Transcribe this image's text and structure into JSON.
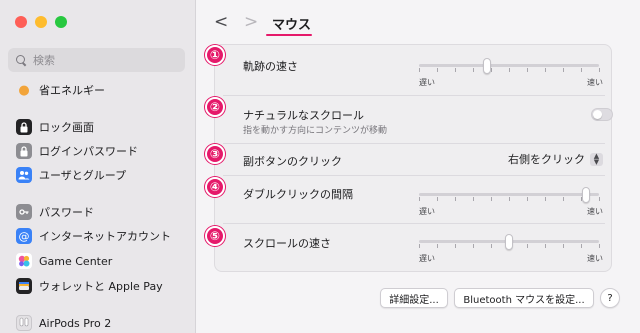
{
  "sidebar": {
    "search_placeholder": "検索",
    "items": [
      {
        "label": "省エネルギー",
        "icon": "lightbulb-icon"
      },
      {
        "label": "ロック画面",
        "icon": "lock-icon"
      },
      {
        "label": "ログインパスワード",
        "icon": "login-lock-icon"
      },
      {
        "label": "ユーザとグループ",
        "icon": "users-icon"
      },
      {
        "label": "パスワード",
        "icon": "key-icon"
      },
      {
        "label": "インターネットアカウント",
        "icon": "at-icon"
      },
      {
        "label": "Game Center",
        "icon": "game-center-icon"
      },
      {
        "label": "ウォレットと Apple Pay",
        "icon": "wallet-icon"
      },
      {
        "label": "AirPods Pro 2",
        "icon": "airpods-icon"
      }
    ]
  },
  "header": {
    "back": "<",
    "forward": ">",
    "title": "マウス"
  },
  "settings": {
    "tracking": {
      "badge": "①",
      "label": "軌跡の速さ",
      "min": "遅い",
      "max": "速い",
      "value": 0.38
    },
    "natural_scroll": {
      "badge": "②",
      "label": "ナチュラルなスクロール",
      "sub": "指を動かす方向にコンテンツが移動",
      "enabled": false
    },
    "secondary_click": {
      "badge": "③",
      "label": "副ボタンのクリック",
      "value": "右側をクリック"
    },
    "double_click": {
      "badge": "④",
      "label": "ダブルクリックの間隔",
      "min": "遅い",
      "max": "速い",
      "value": 0.93
    },
    "scroll_speed": {
      "badge": "⑤",
      "label": "スクロールの速さ",
      "min": "遅い",
      "max": "速い",
      "value": 0.5
    }
  },
  "footer": {
    "advanced": "詳細設定...",
    "bluetooth": "Bluetooth マウスを設定...",
    "help": "?"
  },
  "colors": {
    "accent": "#e5196a",
    "sidebar_bg": "#e9e7ea",
    "panel_bg": "#efeef0"
  }
}
